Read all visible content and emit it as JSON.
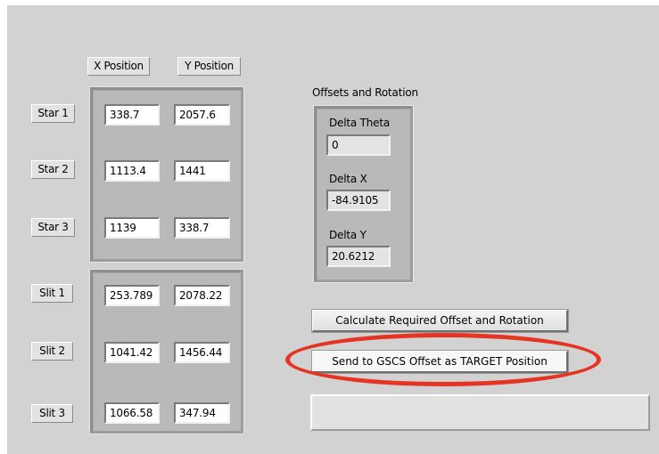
{
  "columns": {
    "x_label": "X Position",
    "y_label": "Y Position"
  },
  "stars": [
    {
      "label": "Star 1",
      "x": "338.7",
      "y": "2057.6"
    },
    {
      "label": "Star 2",
      "x": "1113.4",
      "y": "1441"
    },
    {
      "label": "Star 3",
      "x": "1139",
      "y": "338.7"
    }
  ],
  "slits": [
    {
      "label": "Slit 1",
      "x": "253.789",
      "y": "2078.22"
    },
    {
      "label": "Slit 2",
      "x": "1041.42",
      "y": "1456.44"
    },
    {
      "label": "Slit 3",
      "x": "1066.58",
      "y": "347.94"
    }
  ],
  "offsets": {
    "title": "Offsets and Rotation",
    "delta_theta_label": "Delta Theta",
    "delta_theta": "0",
    "delta_x_label": "Delta X",
    "delta_x": "-84.9105",
    "delta_y_label": "Delta Y",
    "delta_y": "20.6212"
  },
  "buttons": {
    "calculate": "Calculate  Required Offset and Rotation",
    "send": "Send to GSCS Offset as TARGET Position"
  },
  "status": {
    "text": ""
  },
  "colors": {
    "highlight": "#e53422",
    "panel": "#d2d2d2"
  }
}
